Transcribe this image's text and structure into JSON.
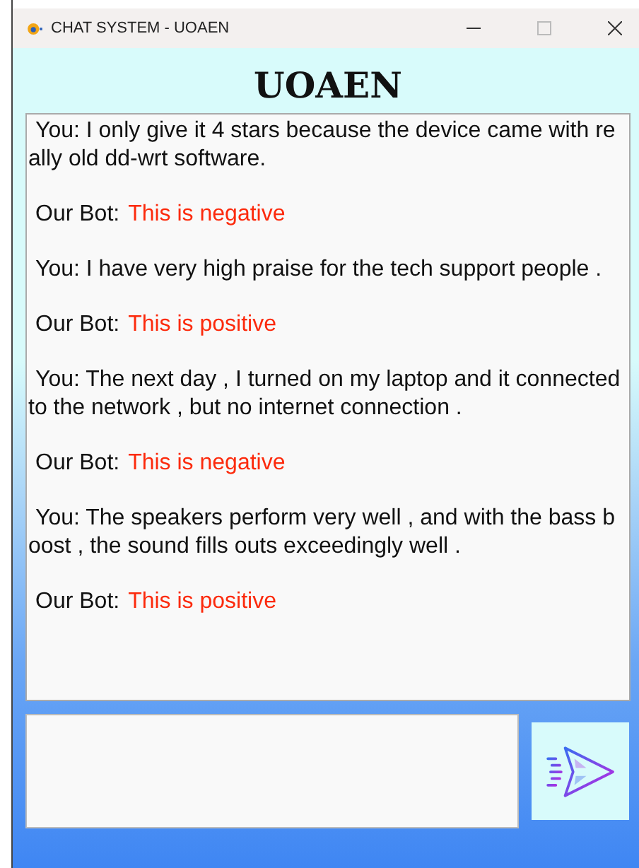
{
  "window": {
    "title": "CHAT SYSTEM - UOAEN"
  },
  "heading": "UOAEN",
  "messages": [
    {
      "kind": "user",
      "text": "You: I only give it 4 stars because the device came with really old dd-wrt software."
    },
    {
      "kind": "bot",
      "label": "Our Bot:",
      "reply": "This is negative"
    },
    {
      "kind": "user",
      "text": "You: I have very high praise for the tech support people ."
    },
    {
      "kind": "bot",
      "label": "Our Bot:",
      "reply": "This is positive"
    },
    {
      "kind": "user",
      "text": "You: The next day , I turned on my laptop and it connected to the network , but no internet connection ."
    },
    {
      "kind": "bot",
      "label": "Our Bot:",
      "reply": "This is negative"
    },
    {
      "kind": "user",
      "text": "You: The speakers perform very well , and with the bass boost , the sound fills outs exceedingly well ."
    },
    {
      "kind": "bot",
      "label": "Our Bot:",
      "reply": "This is positive"
    }
  ]
}
